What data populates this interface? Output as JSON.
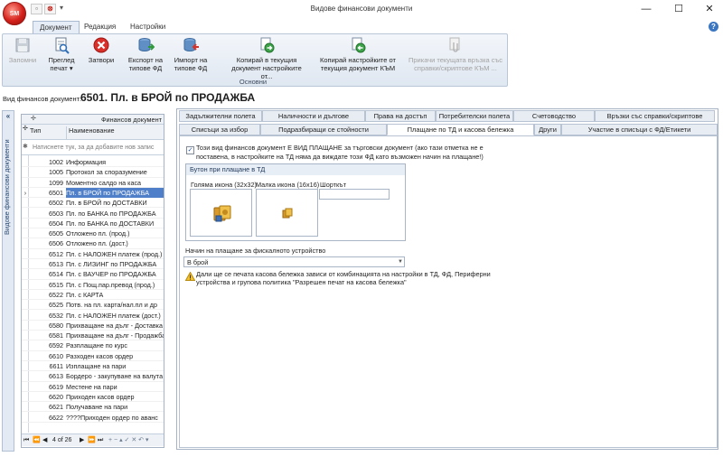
{
  "window": {
    "title": "Видове финансови документи",
    "orb_label": "SM",
    "minimize": "—",
    "maximize": "☐",
    "close": "✕"
  },
  "ribbon": {
    "tabs": [
      {
        "label": "Документ",
        "active": true
      },
      {
        "label": "Редакция",
        "active": false
      },
      {
        "label": "Настройки",
        "active": false
      }
    ],
    "buttons": [
      {
        "label": "Запомни",
        "icon": "save-icon",
        "enabled": false
      },
      {
        "label": "Преглед печат ▾",
        "icon": "print-preview-icon",
        "enabled": true
      },
      {
        "label": "Затвори",
        "icon": "close-icon",
        "enabled": true
      },
      {
        "label": "Експорт на типове ФД",
        "icon": "export-icon",
        "enabled": true
      },
      {
        "label": "Импорт на типове ФД",
        "icon": "import-icon",
        "enabled": true
      },
      {
        "label": "Копирай в текущия документ настройките от...",
        "icon": "copy-into-icon",
        "enabled": true
      },
      {
        "label": "Копирай настройките от текущия документ КЪМ",
        "icon": "copy-from-icon",
        "enabled": true
      },
      {
        "label": "Прикачи текущата връзка със справки/скриптове КЪМ ...",
        "icon": "attach-icon",
        "enabled": false
      }
    ],
    "group_label": "Основни"
  },
  "doc_type": {
    "label": "Вид финансов документ:",
    "value": "6501. Пл. в БРОЙ по ПРОДАЖБА"
  },
  "sidebar": {
    "collapse_glyph": "«",
    "caption": "Видове финансови документи"
  },
  "grid": {
    "group_header": "Финансов документ",
    "columns": [
      "Тип",
      "Наименование"
    ],
    "filter_placeholder": "Натиснете тук, за да добавите нов запис",
    "rows": [
      {
        "code": "1002",
        "name": "Информация"
      },
      {
        "code": "1005",
        "name": "Протокол за споразумение"
      },
      {
        "code": "1099",
        "name": "Моментно салдо на каса"
      },
      {
        "code": "6501",
        "name": "Пл. в БРОЙ по ПРОДАЖБА",
        "selected": true
      },
      {
        "code": "6502",
        "name": "Пл. в БРОЙ по ДОСТАВКИ"
      },
      {
        "code": "6503",
        "name": "Пл. по БАНКА по ПРОДАЖБА"
      },
      {
        "code": "6504",
        "name": "Пл. по БАНКА по ДОСТАВКИ"
      },
      {
        "code": "6505",
        "name": "Отложено пл. (прод.)"
      },
      {
        "code": "6506",
        "name": "Отложено пл.  (дост.)"
      },
      {
        "code": "6512",
        "name": "Пл. с НАЛОЖЕН платеж (прод.)"
      },
      {
        "code": "6513",
        "name": "Пл. с ЛИЗИНГ по ПРОДАЖБА"
      },
      {
        "code": "6514",
        "name": "Пл. с ВАУЧЕР по ПРОДАЖБА"
      },
      {
        "code": "6515",
        "name": "Пл. с Пощ.пар.превод (прод.)"
      },
      {
        "code": "6522",
        "name": "Пл. с КАРТА"
      },
      {
        "code": "6525",
        "name": "Потв. на пл. карта/нал.пл и др"
      },
      {
        "code": "6532",
        "name": "Пл. с НАЛОЖЕН платеж (дост.)"
      },
      {
        "code": "6580",
        "name": "Прихващане на дълг - Доставка"
      },
      {
        "code": "6581",
        "name": "Прихващане на дълг - Продажба"
      },
      {
        "code": "6592",
        "name": "Разплащане по курс"
      },
      {
        "code": "6610",
        "name": "Разходен касов ордер"
      },
      {
        "code": "6611",
        "name": "Изплащане на пари"
      },
      {
        "code": "6613",
        "name": "Бордеро - закупуване на валута"
      },
      {
        "code": "6619",
        "name": "Местене на пари"
      },
      {
        "code": "6620",
        "name": "Приходен касов ордер"
      },
      {
        "code": "6621",
        "name": "Получаване на пари"
      },
      {
        "code": "6622",
        "name": "????Приходен ордер по аванс"
      }
    ],
    "navigator": {
      "first": "⏮",
      "prev_page": "⏪",
      "prev": "◀",
      "position": "4 of 26",
      "next": "▶",
      "next_page": "⏩",
      "last": "⏭",
      "tools": "+  −  ▴  ✓  ✕  ↶  ▾"
    }
  },
  "tabs_row1": [
    "Задължителни полета",
    "Наличности и дългове",
    "Права на достъп",
    "Потребителски полета",
    "Счетоводство",
    "Връзки със справки/скриптове"
  ],
  "tabs_row2": [
    "Списъци за избор",
    "Подразбиращи се стойности",
    "Плащане по ТД и касова бележка",
    "Други",
    "Участие в списъци с ФД/Етикети"
  ],
  "active_tab": "Плащане по ТД и касова бележка",
  "payment": {
    "checkbox_checked": true,
    "checkbox_text": "Този вид финансов документ Е ВИД ПЛАЩАНЕ за търговски документ (ако тази отметка не е поставена, в настройките на ТД няма да виждате този ФД като възможен начин на плащане!)",
    "button_group_title": "Бутон при плащане в ТД",
    "large_icon_label": "Голяма икона (32x32)",
    "small_icon_label": "Малка икона (16x16)",
    "shortcut_label": "Шорткът",
    "shortcut_value": "",
    "fiscal_label": "Начин на плащане за фискалното устройство",
    "fiscal_value": "В брой",
    "warning_text": "Дали ще се печата касова бележка зависи от комбинацията на настройки в ТД, ФД, Периферни устройства и групова политика \"Разрешен печат на касова бележка\""
  }
}
